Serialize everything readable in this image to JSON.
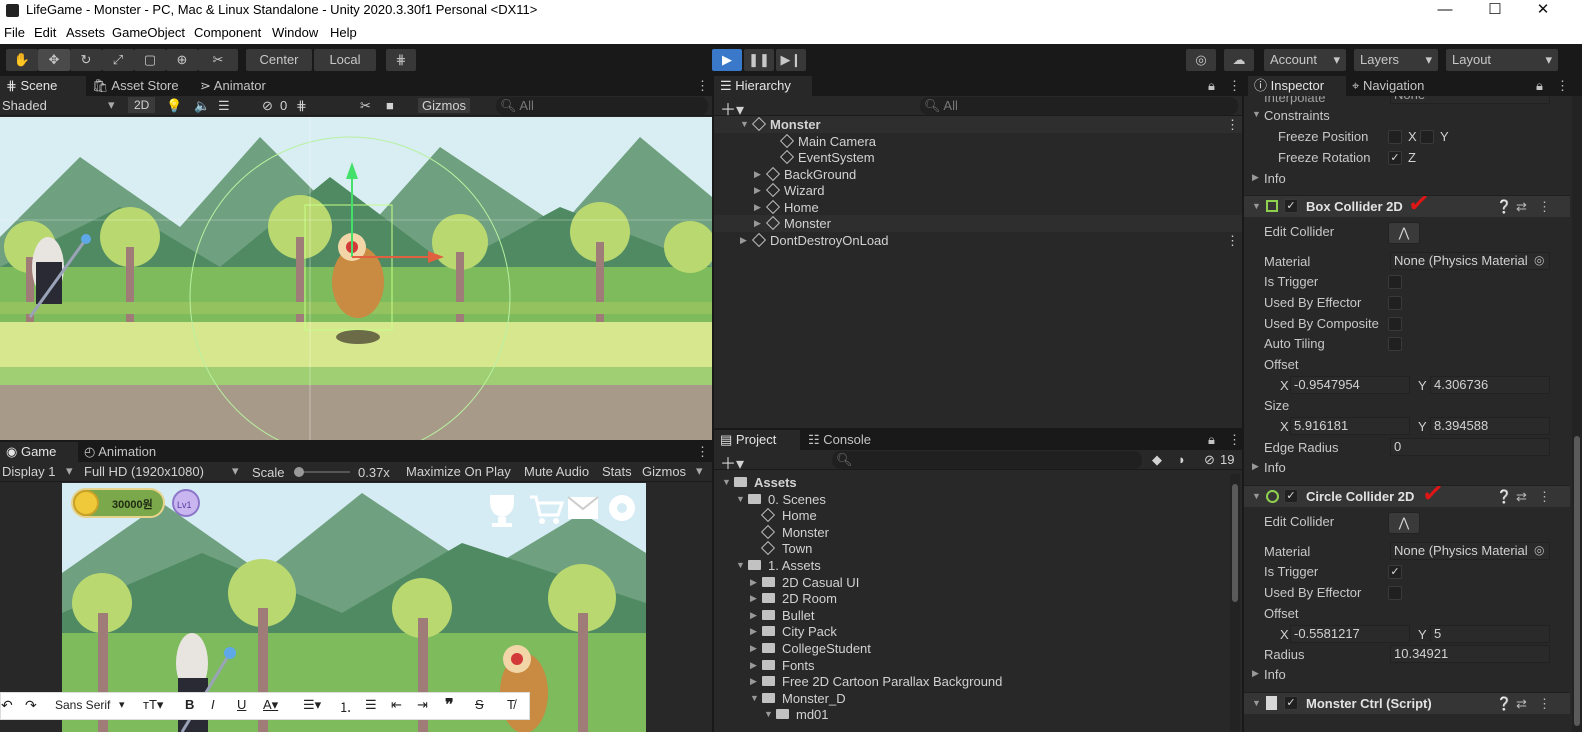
{
  "window": {
    "title": "LifeGame - Monster - PC, Mac & Linux Standalone - Unity 2020.3.30f1 Personal <DX11>",
    "min": "—",
    "max": "☐",
    "close": "✕"
  },
  "menu": [
    "File",
    "Edit",
    "Assets",
    "GameObject",
    "Component",
    "Window",
    "Help"
  ],
  "toolbar": {
    "center": "Center",
    "local": "Local",
    "account": "Account",
    "layers": "Layers",
    "layout": "Layout",
    "arrow": "▾"
  },
  "scene": {
    "tabs": [
      "Scene",
      "Asset Store",
      "Animator"
    ],
    "shading": "Shaded",
    "mode2d": "2D",
    "hidden_count": "0",
    "gizmos": "Gizmos",
    "search_placeholder": "All"
  },
  "game": {
    "tabs": [
      "Game",
      "Animation"
    ],
    "display": "Display 1",
    "resolution": "Full HD (1920x1080)",
    "scale_label": "Scale",
    "scale_value": "0.37x",
    "maximize": "Maximize On Play",
    "mute": "Mute Audio",
    "stats": "Stats",
    "gizmos": "Gizmos",
    "coins": "30000원",
    "level": "Lv1"
  },
  "editor_toolbar": {
    "font": "Sans Serif"
  },
  "hierarchy": {
    "tab": "Hierarchy",
    "search_placeholder": "All",
    "items": [
      {
        "label": "Monster",
        "indent": 0,
        "kind": "scene",
        "expanded": true
      },
      {
        "label": "Main Camera",
        "indent": 2,
        "kind": "obj"
      },
      {
        "label": "EventSystem",
        "indent": 2,
        "kind": "obj"
      },
      {
        "label": "BackGround",
        "indent": 1,
        "kind": "obj",
        "arrow": true
      },
      {
        "label": "Wizard",
        "indent": 1,
        "kind": "obj",
        "arrow": true
      },
      {
        "label": "Home",
        "indent": 1,
        "kind": "obj",
        "arrow": true
      },
      {
        "label": "Monster",
        "indent": 1,
        "kind": "obj",
        "arrow": true
      },
      {
        "label": "DontDestroyOnLoad",
        "indent": 0,
        "kind": "scene",
        "arrow": true
      }
    ]
  },
  "project": {
    "tabs": [
      "Project",
      "Console"
    ],
    "hidden_count": "19",
    "items": [
      {
        "label": "Assets",
        "indent": 0,
        "bold": true,
        "arrow": "▼"
      },
      {
        "label": "0. Scenes",
        "indent": 1,
        "arrow": "▼"
      },
      {
        "label": "Home",
        "indent": 2,
        "scene": true
      },
      {
        "label": "Monster",
        "indent": 2,
        "scene": true
      },
      {
        "label": "Town",
        "indent": 2,
        "scene": true
      },
      {
        "label": "1. Assets",
        "indent": 1,
        "arrow": "▼"
      },
      {
        "label": "2D Casual UI",
        "indent": 2,
        "arrow": "▶"
      },
      {
        "label": "2D Room",
        "indent": 2,
        "arrow": "▶"
      },
      {
        "label": "Bullet",
        "indent": 2,
        "arrow": "▶"
      },
      {
        "label": "City Pack",
        "indent": 2,
        "arrow": "▶"
      },
      {
        "label": "CollegeStudent",
        "indent": 2,
        "arrow": "▶"
      },
      {
        "label": "Fonts",
        "indent": 2,
        "arrow": "▶"
      },
      {
        "label": "Free 2D Cartoon Parallax Background",
        "indent": 2,
        "arrow": "▶"
      },
      {
        "label": "Monster_D",
        "indent": 2,
        "arrow": "▼"
      },
      {
        "label": "md01",
        "indent": 3,
        "arrow": "▼"
      }
    ]
  },
  "inspector": {
    "tabs": [
      "Inspector",
      "Navigation"
    ],
    "interpolate": {
      "label": "Interpolate",
      "value": "None"
    },
    "constraints": "Constraints",
    "freeze_position": "Freeze Position",
    "freeze_rotation": "Freeze Rotation",
    "x": "X",
    "y": "Y",
    "z": "Z",
    "info": "Info",
    "box": {
      "title": "Box Collider 2D",
      "edit": "Edit Collider",
      "material_label": "Material",
      "material": "None (Physics Material",
      "is_trigger": "Is Trigger",
      "used_by_effector": "Used By Effector",
      "used_by_composite": "Used By Composite",
      "auto_tiling": "Auto Tiling",
      "offset": "Offset",
      "offset_x": "-0.9547954",
      "offset_y": "4.306736",
      "size": "Size",
      "size_x": "5.916181",
      "size_y": "8.394588",
      "edge_radius": "Edge Radius",
      "edge_value": "0"
    },
    "circle": {
      "title": "Circle Collider 2D",
      "edit": "Edit Collider",
      "material_label": "Material",
      "material": "None (Physics Material",
      "is_trigger": "Is Trigger",
      "used_by_effector": "Used By Effector",
      "offset": "Offset",
      "offset_x": "-0.5581217",
      "offset_y": "5",
      "radius": "Radius",
      "radius_value": "10.34921"
    },
    "script": {
      "title": "Monster Ctrl (Script)"
    }
  }
}
